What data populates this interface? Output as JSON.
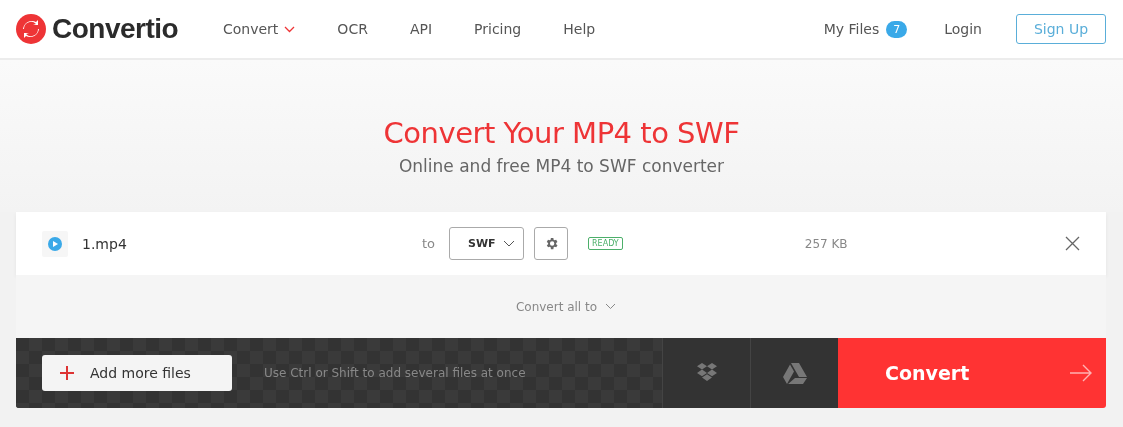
{
  "logo": {
    "text": "Convertio"
  },
  "nav": [
    {
      "label": "Convert",
      "has_menu": true
    },
    {
      "label": "OCR",
      "has_menu": false
    },
    {
      "label": "API",
      "has_menu": false
    },
    {
      "label": "Pricing",
      "has_menu": false
    },
    {
      "label": "Help",
      "has_menu": false
    }
  ],
  "account": {
    "my_files": "My Files",
    "files_count": "7",
    "login": "Login",
    "signup": "Sign Up"
  },
  "hero": {
    "title": "Convert Your MP4 to SWF",
    "subtitle": "Online and free MP4 to SWF converter"
  },
  "files": [
    {
      "name": "1.mp4",
      "to": "to",
      "format": "SWF",
      "status": "READY",
      "size": "257 KB"
    }
  ],
  "convert_all": "Convert all to",
  "actions": {
    "add": "Add more files",
    "hint": "Use Ctrl or Shift to add several files at once",
    "convert": "Convert"
  }
}
